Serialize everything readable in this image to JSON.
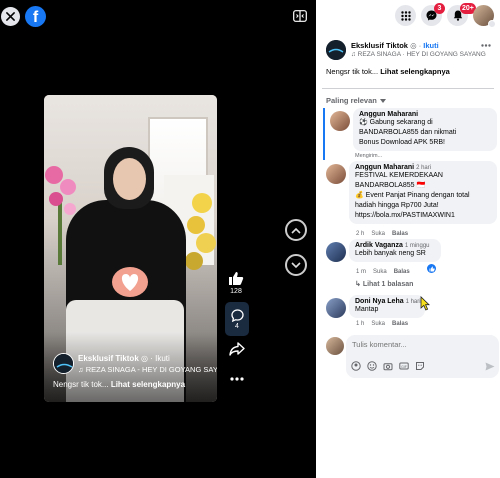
{
  "viewer": {
    "logo_letter": "f",
    "video": {
      "author": "Eksklusif Tiktok",
      "follow_label": "Ikuti",
      "music": "♫ REZA SINAGA - HEY DI GOYANG SAYA",
      "caption": "Nengsr tik tok...",
      "see_more": "Lihat selengkapnya"
    },
    "actions": {
      "like_count": "128",
      "comment_count": "4"
    }
  },
  "topbar": {
    "messenger_badge": "3",
    "notifications_badge": "20+"
  },
  "post": {
    "author": "Eksklusif Tiktok",
    "follow_label": "Ikuti",
    "music": "♫ REZA SINAGA · HEY DI GOYANG SAYANG",
    "caption": "Nengsr tik tok...",
    "see_more": "Lihat selengkapnya"
  },
  "comments": {
    "sort_label": "Paling relevan",
    "items": [
      {
        "name": "Anggun Maharani",
        "time": "",
        "lines": [
          "⚽ Gabung sekarang di",
          "BANDARBOLA855 dan nikmati",
          "Bonus Download APK 5RB!"
        ],
        "status": "Mengirim..."
      },
      {
        "name": "Anggun Maharani",
        "time": "2 hari",
        "lines": [
          "FESTIVAL KEMERDEKAAN",
          "BANDARBOLA855 🇮🇩",
          "💰 Event Panjat Pinang dengan total",
          "hadiah hingga Rp700 Juta!",
          "https://bola.mx/PASTIMAXWIN1"
        ],
        "time_meta": "2 h",
        "like_label": "Suka",
        "reply_label": "Balas"
      },
      {
        "name": "Ardik Vaganza",
        "time": "1 minggu",
        "lines": [
          "Lebih banyak neng SR"
        ],
        "time_meta": "1 m",
        "like_label": "Suka",
        "reply_label": "Balas"
      },
      {
        "name": "Doni Nya Leha",
        "time": "1 hari",
        "lines": [
          "Mantap"
        ],
        "time_meta": "1 h",
        "like_label": "Suka",
        "reply_label": "Balas"
      }
    ],
    "replies_label": "Lihat 1 balasan"
  },
  "composer": {
    "placeholder": "Tulis komentar..."
  },
  "colors": {
    "facebook_blue": "#1877f2",
    "badge_red": "#e41e3f",
    "bubble_gray": "#f0f2f5"
  }
}
